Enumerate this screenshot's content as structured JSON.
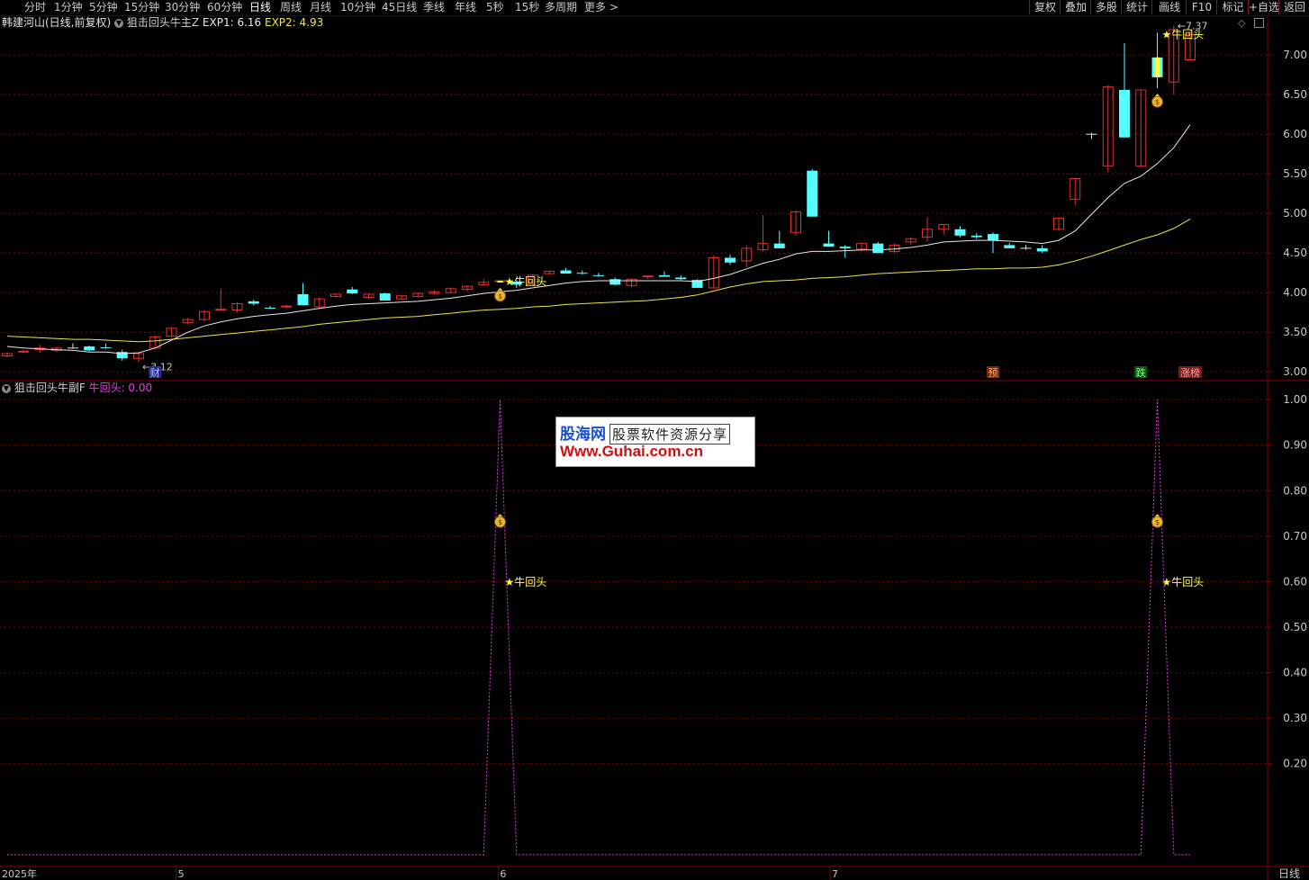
{
  "toolbar": {
    "timeframes": [
      "分时",
      "1分钟",
      "5分钟",
      "15分钟",
      "30分钟",
      "60分钟",
      "日线",
      "周线",
      "月线",
      "10分钟",
      "45日线",
      "季线",
      "年线",
      "5秒",
      "15秒",
      "多周期",
      "更多 >"
    ],
    "active_timeframe": "日线",
    "buttons": [
      "复权",
      "叠加",
      "多股",
      "统计",
      "画线",
      "F10",
      "标记",
      "+自选",
      "返回"
    ]
  },
  "main_header": {
    "stock": "韩建河山(日线,前复权)",
    "indicator": "狙击回头牛主Z",
    "exp1_label": "EXP1: 6.16",
    "exp2_label": "EXP2: 4.93"
  },
  "sub_header": {
    "indicator": "狙击回头牛副F",
    "value_label": "牛回头: 0.00"
  },
  "main_axis": {
    "min": 2.9,
    "max": 7.4,
    "ticks": [
      "7.00",
      "6.50",
      "6.00",
      "5.50",
      "5.00",
      "4.50",
      "4.00",
      "3.50",
      "3.00"
    ]
  },
  "sub_axis": {
    "min": -0.02,
    "max": 1.02,
    "ticks": [
      "1.00",
      "0.90",
      "0.80",
      "0.70",
      "0.60",
      "0.50",
      "0.40",
      "0.30",
      "0.20"
    ]
  },
  "annotations": {
    "high_label": "7.37",
    "low_label": "3.12",
    "signal_text": "★牛回头",
    "bag_icon": "money-bag-icon"
  },
  "event_markers": [
    "财",
    "预",
    "跌",
    "涨榜"
  ],
  "x_axis": {
    "labels": [
      "2025年",
      "5",
      "6",
      "7"
    ],
    "period_label": "日线"
  },
  "watermark": {
    "logo": "股海网",
    "tagline": "股票软件资源分享",
    "url": "Www.Guhai.com.cn"
  },
  "colors": {
    "up": "#e03030",
    "down": "#54ffff",
    "exp1": "#e8e8e8",
    "exp2": "#e8e840",
    "signal": "#e040e0",
    "grid": "#8a0000"
  },
  "chart_data": {
    "type": "candlestick",
    "series": [
      {
        "name": "K线",
        "ohlc": [
          [
            3.2,
            3.24,
            3.18,
            3.23
          ],
          [
            3.25,
            3.28,
            3.24,
            3.26
          ],
          [
            3.28,
            3.34,
            3.24,
            3.3
          ],
          [
            3.27,
            3.31,
            3.25,
            3.3
          ],
          [
            3.3,
            3.36,
            3.29,
            3.3
          ],
          [
            3.32,
            3.33,
            3.26,
            3.27
          ],
          [
            3.31,
            3.36,
            3.29,
            3.3
          ],
          [
            3.25,
            3.28,
            3.14,
            3.17
          ],
          [
            3.17,
            3.24,
            3.12,
            3.23
          ],
          [
            3.3,
            3.46,
            3.3,
            3.44
          ],
          [
            3.45,
            3.56,
            3.44,
            3.55
          ],
          [
            3.62,
            3.68,
            3.6,
            3.66
          ],
          [
            3.66,
            3.78,
            3.63,
            3.76
          ],
          [
            3.78,
            4.05,
            3.77,
            3.79
          ],
          [
            3.78,
            3.88,
            3.75,
            3.86
          ],
          [
            3.89,
            3.91,
            3.84,
            3.86
          ],
          [
            3.81,
            3.83,
            3.79,
            3.8
          ],
          [
            3.82,
            3.85,
            3.8,
            3.83
          ],
          [
            3.98,
            4.12,
            3.84,
            3.84
          ],
          [
            3.82,
            3.94,
            3.8,
            3.92
          ],
          [
            3.95,
            3.99,
            3.94,
            3.98
          ],
          [
            4.04,
            4.07,
            3.98,
            3.99
          ],
          [
            3.94,
            3.99,
            3.92,
            3.98
          ],
          [
            3.99,
            4.0,
            3.9,
            3.9
          ],
          [
            3.92,
            3.97,
            3.91,
            3.96
          ],
          [
            3.95,
            4.0,
            3.94,
            3.99
          ],
          [
            3.99,
            4.03,
            3.98,
            4.01
          ],
          [
            4.0,
            4.06,
            3.99,
            4.05
          ],
          [
            4.04,
            4.09,
            4.02,
            4.08
          ],
          [
            4.1,
            4.17,
            4.1,
            4.13
          ],
          [
            4.14,
            4.16,
            4.13,
            4.15
          ],
          [
            4.14,
            4.16,
            4.06,
            4.1
          ],
          [
            4.09,
            4.23,
            4.08,
            4.22
          ],
          [
            4.24,
            4.28,
            4.23,
            4.27
          ],
          [
            4.28,
            4.31,
            4.24,
            4.24
          ],
          [
            4.25,
            4.28,
            4.23,
            4.24
          ],
          [
            4.22,
            4.25,
            4.2,
            4.21
          ],
          [
            4.17,
            4.19,
            4.09,
            4.1
          ],
          [
            4.09,
            4.18,
            4.07,
            4.17
          ],
          [
            4.2,
            4.22,
            4.17,
            4.21
          ],
          [
            4.22,
            4.27,
            4.2,
            4.2
          ],
          [
            4.19,
            4.22,
            4.16,
            4.17
          ],
          [
            4.16,
            4.17,
            4.06,
            4.06
          ],
          [
            4.06,
            4.47,
            4.05,
            4.44
          ],
          [
            4.44,
            4.48,
            4.35,
            4.38
          ],
          [
            4.4,
            4.6,
            4.32,
            4.56
          ],
          [
            4.54,
            4.98,
            4.52,
            4.62
          ],
          [
            4.62,
            4.78,
            4.56,
            4.56
          ],
          [
            4.76,
            5.04,
            4.72,
            5.02
          ],
          [
            5.54,
            5.56,
            4.98,
            4.96
          ],
          [
            4.62,
            4.78,
            4.58,
            4.58
          ],
          [
            4.58,
            4.6,
            4.44,
            4.56
          ],
          [
            4.55,
            4.63,
            4.52,
            4.62
          ],
          [
            4.62,
            4.64,
            4.5,
            4.5
          ],
          [
            4.52,
            4.62,
            4.5,
            4.6
          ],
          [
            4.64,
            4.7,
            4.6,
            4.68
          ],
          [
            4.7,
            4.95,
            4.64,
            4.8
          ],
          [
            4.8,
            4.86,
            4.73,
            4.86
          ],
          [
            4.8,
            4.84,
            4.7,
            4.72
          ],
          [
            4.72,
            4.75,
            4.68,
            4.7
          ],
          [
            4.74,
            4.76,
            4.5,
            4.66
          ],
          [
            4.6,
            4.63,
            4.56,
            4.56
          ],
          [
            4.56,
            4.6,
            4.54,
            4.56
          ],
          [
            4.56,
            4.6,
            4.5,
            4.52
          ],
          [
            4.8,
            4.94,
            4.78,
            4.94
          ],
          [
            5.18,
            5.44,
            5.1,
            5.44
          ],
          [
            6.0,
            6.02,
            5.94,
            6.0
          ],
          [
            5.6,
            6.62,
            5.52,
            6.6
          ],
          [
            6.56,
            7.15,
            5.96,
            5.96
          ],
          [
            5.6,
            6.56,
            5.6,
            6.56
          ],
          [
            6.97,
            7.28,
            6.58,
            6.72
          ],
          [
            6.66,
            7.37,
            6.5,
            7.32
          ],
          [
            6.94,
            7.32,
            6.92,
            7.26
          ]
        ]
      },
      {
        "name": "EXP1",
        "values": [
          3.32,
          3.3,
          3.29,
          3.28,
          3.27,
          3.25,
          3.25,
          3.23,
          3.24,
          3.3,
          3.4,
          3.5,
          3.58,
          3.63,
          3.67,
          3.7,
          3.72,
          3.74,
          3.77,
          3.8,
          3.83,
          3.85,
          3.86,
          3.87,
          3.88,
          3.89,
          3.91,
          3.93,
          3.96,
          3.99,
          4.01,
          4.03,
          4.06,
          4.09,
          4.12,
          4.14,
          4.15,
          4.15,
          4.15,
          4.15,
          4.15,
          4.15,
          4.14,
          4.18,
          4.23,
          4.3,
          4.37,
          4.42,
          4.49,
          4.52,
          4.52,
          4.53,
          4.54,
          4.54,
          4.55,
          4.57,
          4.6,
          4.64,
          4.65,
          4.66,
          4.66,
          4.65,
          4.64,
          4.62,
          4.66,
          4.78,
          4.99,
          5.2,
          5.38,
          5.47,
          5.63,
          5.83,
          6.12
        ]
      },
      {
        "name": "EXP2",
        "values": [
          3.45,
          3.44,
          3.43,
          3.42,
          3.41,
          3.41,
          3.4,
          3.39,
          3.38,
          3.39,
          3.41,
          3.43,
          3.45,
          3.47,
          3.49,
          3.51,
          3.53,
          3.55,
          3.57,
          3.6,
          3.62,
          3.64,
          3.66,
          3.68,
          3.69,
          3.7,
          3.72,
          3.74,
          3.76,
          3.78,
          3.79,
          3.8,
          3.82,
          3.83,
          3.85,
          3.86,
          3.87,
          3.88,
          3.89,
          3.9,
          3.92,
          3.94,
          3.97,
          4.02,
          4.07,
          4.11,
          4.14,
          4.15,
          4.16,
          4.18,
          4.19,
          4.2,
          4.22,
          4.24,
          4.25,
          4.26,
          4.27,
          4.28,
          4.29,
          4.3,
          4.3,
          4.31,
          4.31,
          4.32,
          4.35,
          4.4,
          4.46,
          4.53,
          4.6,
          4.67,
          4.73,
          4.81,
          4.93
        ]
      },
      {
        "name": "牛回头",
        "values": [
          0,
          0,
          0,
          0,
          0,
          0,
          0,
          0,
          0,
          0,
          0,
          0,
          0,
          0,
          0,
          0,
          0,
          0,
          0,
          0,
          0,
          0,
          0,
          0,
          0,
          0,
          0,
          0,
          0,
          0,
          1,
          0,
          0,
          0,
          0,
          0,
          0,
          0,
          0,
          0,
          0,
          0,
          0,
          0,
          0,
          0,
          0,
          0,
          0,
          0,
          0,
          0,
          0,
          0,
          0,
          0,
          0,
          0,
          0,
          0,
          0,
          0,
          0,
          0,
          0,
          0,
          0,
          0,
          0,
          0,
          1,
          0,
          0
        ]
      }
    ],
    "signal_indices": [
      30,
      70
    ],
    "high": 7.37,
    "low": 3.12
  }
}
